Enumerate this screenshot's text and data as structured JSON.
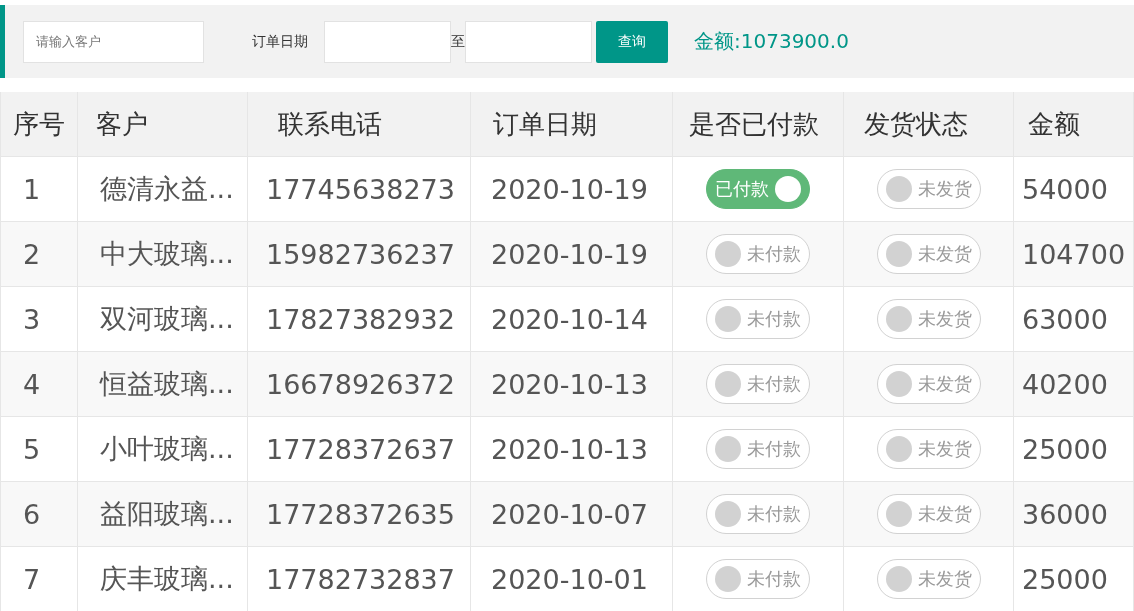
{
  "toolbar": {
    "customer_field": {
      "placeholder": "请输入客户"
    },
    "date_label": "订单日期",
    "date_separator": "至",
    "query_button": "查询",
    "total": "金额:1073900.0"
  },
  "table": {
    "columns": [
      "序号",
      "客户",
      "联系电话",
      "订单日期",
      "是否已付款",
      "发货状态",
      "金额"
    ],
    "rows": [
      {
        "index": "1",
        "customer": "德清永益...",
        "phone": "17745638273",
        "date": "2020-10-19",
        "paid": {
          "label": "已付款",
          "on": true
        },
        "shipped": {
          "label": "未发货",
          "on": false
        },
        "amount": "54000"
      },
      {
        "index": "2",
        "customer": "中大玻璃...",
        "phone": "15982736237",
        "date": "2020-10-19",
        "paid": {
          "label": "未付款",
          "on": false
        },
        "shipped": {
          "label": "未发货",
          "on": false
        },
        "amount": "104700"
      },
      {
        "index": "3",
        "customer": "双河玻璃...",
        "phone": "17827382932",
        "date": "2020-10-14",
        "paid": {
          "label": "未付款",
          "on": false
        },
        "shipped": {
          "label": "未发货",
          "on": false
        },
        "amount": "63000"
      },
      {
        "index": "4",
        "customer": "恒益玻璃...",
        "phone": "16678926372",
        "date": "2020-10-13",
        "paid": {
          "label": "未付款",
          "on": false
        },
        "shipped": {
          "label": "未发货",
          "on": false
        },
        "amount": "40200"
      },
      {
        "index": "5",
        "customer": "小叶玻璃...",
        "phone": "17728372637",
        "date": "2020-10-13",
        "paid": {
          "label": "未付款",
          "on": false
        },
        "shipped": {
          "label": "未发货",
          "on": false
        },
        "amount": "25000"
      },
      {
        "index": "6",
        "customer": "益阳玻璃...",
        "phone": "17728372635",
        "date": "2020-10-07",
        "paid": {
          "label": "未付款",
          "on": false
        },
        "shipped": {
          "label": "未发货",
          "on": false
        },
        "amount": "36000"
      },
      {
        "index": "7",
        "customer": "庆丰玻璃...",
        "phone": "17782732837",
        "date": "2020-10-01",
        "paid": {
          "label": "未付款",
          "on": false
        },
        "shipped": {
          "label": "未发货",
          "on": false
        },
        "amount": "25000"
      }
    ]
  }
}
